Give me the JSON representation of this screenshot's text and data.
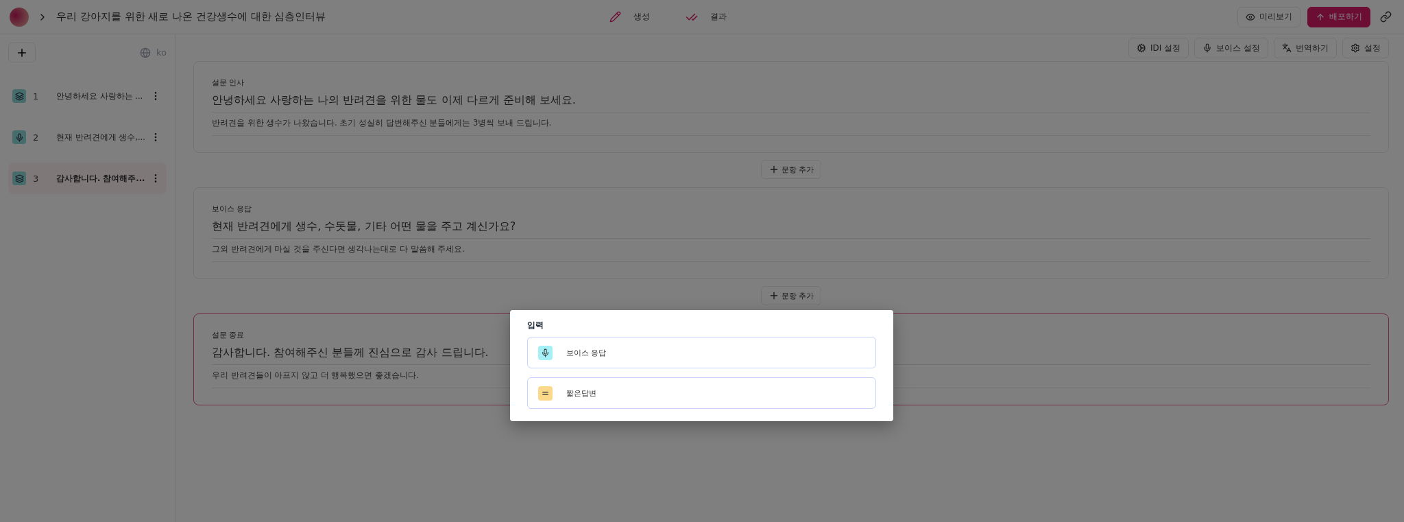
{
  "header": {
    "title": "우리 강아지를 위한 새로 나온 건강생수에 대한 심층인터뷰",
    "nav": [
      {
        "label": "생성",
        "kind": "create"
      },
      {
        "label": "결과",
        "kind": "results"
      }
    ],
    "actions": [
      {
        "label": "미리보기",
        "kind": "preview"
      },
      {
        "label": "배포하기",
        "kind": "deploy"
      }
    ]
  },
  "sidebar": {
    "language": "ko",
    "items": [
      {
        "number": "1",
        "label": "안녕하세요 사랑하는 ...",
        "kind": "intro",
        "selected": false
      },
      {
        "number": "2",
        "label": "현재 반려견에게 생수,...",
        "kind": "voice",
        "selected": false
      },
      {
        "number": "3",
        "label": "감사합니다. 참여해주...",
        "kind": "outro",
        "selected": true
      }
    ]
  },
  "toolbar": [
    {
      "label": "IDI 설정",
      "kind": "idi"
    },
    {
      "label": "보이스 설정",
      "kind": "voice"
    },
    {
      "label": "번역하기",
      "kind": "translate"
    },
    {
      "label": "설정",
      "kind": "settings"
    }
  ],
  "questions": [
    {
      "type_label": "설문 인사",
      "title": "안녕하세요 사랑하는 나의 반려견을 위한 물도 이제 다르게 준비해 보세요.",
      "description": "반려견을 위한 생수가 나왔습니다. 초기 성실히 답변해주신 분들에게는 3병씩 보내 드립니다.",
      "selected": false,
      "add_button": "문항 추가"
    },
    {
      "type_label": "보이스 응답",
      "title": "현재 반려견에게 생수, 수돗물, 기타 어떤 물을 주고 계신가요?",
      "description": "그외 반려견에게 마실 것을 주신다면 생각나는대로 다 말씀해 주세요.",
      "selected": false,
      "add_button": "문항 추가"
    },
    {
      "type_label": "설문 종료",
      "title": "감사합니다. 참여해주신 분들께 진심으로 감사 드립니다.",
      "description": "우리 반려견들이 아프지 않고 더 행복했으면 좋겠습니다.",
      "selected": true
    }
  ],
  "modal": {
    "title": "입력",
    "options": [
      {
        "label": "보이스 응답",
        "kind": "voice"
      },
      {
        "label": "짧은답변",
        "kind": "short"
      }
    ]
  }
}
